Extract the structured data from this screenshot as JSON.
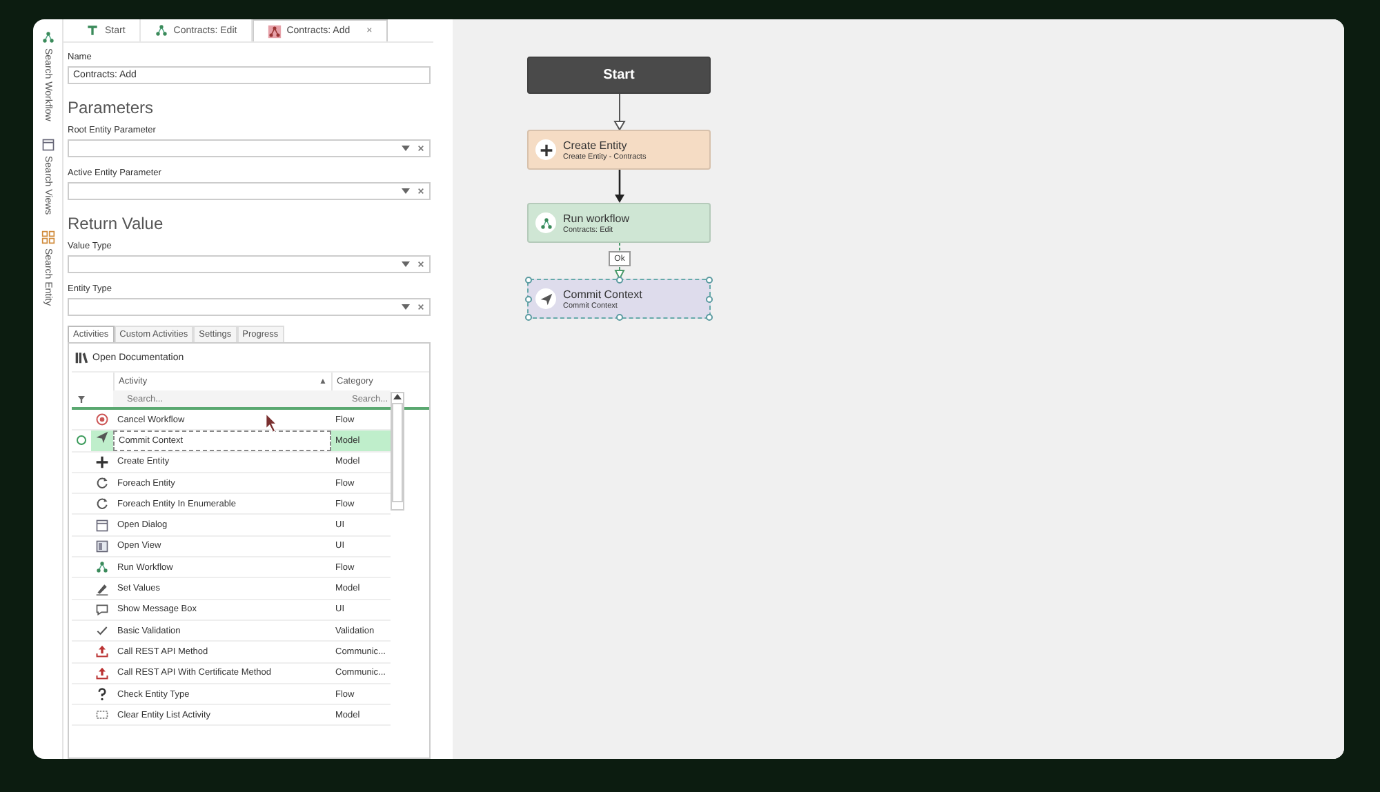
{
  "tabs": [
    {
      "label": "Start",
      "selected": false,
      "kind": "start"
    },
    {
      "label": "Contracts: Edit",
      "selected": false,
      "kind": "workflow"
    },
    {
      "label": "Contracts: Add",
      "selected": true,
      "kind": "workflow-active",
      "close": "×"
    }
  ],
  "sidebar": [
    {
      "label": "Search Workflow",
      "kind": "workflow"
    },
    {
      "label": "Search Views",
      "kind": "view"
    },
    {
      "label": "Search Entity",
      "kind": "entity"
    }
  ],
  "name_field": {
    "label": "Name",
    "value": "Contracts: Add"
  },
  "sections": [
    {
      "heading": "Parameters",
      "fields": [
        {
          "label": "Root Entity Parameter"
        },
        {
          "label": "Active Entity Parameter"
        }
      ]
    },
    {
      "heading": "Return Value",
      "fields": [
        {
          "label": "Value Type"
        },
        {
          "label": "Entity Type"
        }
      ]
    }
  ],
  "panel_tabs": [
    {
      "label": "Activities",
      "selected": true
    },
    {
      "label": "Custom Activities",
      "selected": false
    },
    {
      "label": "Settings",
      "selected": false
    },
    {
      "label": "Progress",
      "selected": false
    }
  ],
  "open_documentation": "Open Documentation",
  "table": {
    "columns": [
      {
        "label": "Activity",
        "sort": "▲"
      },
      {
        "label": "Category"
      }
    ],
    "search_placeholders": [
      "Search...",
      "Search..."
    ],
    "rows": [
      {
        "activity": "Cancel Workflow",
        "category": "Flow",
        "kind": "cancel",
        "selected": false
      },
      {
        "activity": "Commit Context",
        "category": "Model",
        "kind": "send",
        "selected": true
      },
      {
        "activity": "Create Entity",
        "category": "Model",
        "kind": "plus",
        "selected": false
      },
      {
        "activity": "Foreach Entity",
        "category": "Flow",
        "kind": "loop",
        "selected": false
      },
      {
        "activity": "Foreach Entity In Enumerable",
        "category": "Flow",
        "kind": "loop",
        "selected": false
      },
      {
        "activity": "Open Dialog",
        "category": "UI",
        "kind": "dialog",
        "selected": false
      },
      {
        "activity": "Open View",
        "category": "UI",
        "kind": "view",
        "selected": false
      },
      {
        "activity": "Run Workflow",
        "category": "Flow",
        "kind": "workflow",
        "selected": false
      },
      {
        "activity": "Set Values",
        "category": "Model",
        "kind": "pen",
        "selected": false
      },
      {
        "activity": "Show Message Box",
        "category": "UI",
        "kind": "message",
        "selected": false
      },
      {
        "activity": "Basic Validation",
        "category": "Validation",
        "kind": "check",
        "selected": false
      },
      {
        "activity": "Call REST API Method",
        "category": "Communic...",
        "kind": "upload",
        "selected": false
      },
      {
        "activity": "Call REST API With Certificate Method",
        "category": "Communic...",
        "kind": "upload",
        "selected": false
      },
      {
        "activity": "Check Entity Type",
        "category": "Flow",
        "kind": "question",
        "selected": false
      },
      {
        "activity": "Clear Entity List Activity",
        "category": "Model",
        "kind": "list",
        "selected": false
      }
    ]
  },
  "canvas": {
    "nodes": [
      {
        "title": "Start",
        "kind": "start",
        "color": "#4a4a4a",
        "selected": false
      },
      {
        "title": "Create Entity",
        "subtitle": "Create Entity - Contracts",
        "kind": "plus",
        "color": "#f5dcc4",
        "selected": false
      },
      {
        "title": "Run workflow",
        "subtitle": "Contracts: Edit",
        "kind": "workflow",
        "color": "#cfe6d4",
        "selected": false
      },
      {
        "title": "Commit Context",
        "subtitle": "Commit Context",
        "kind": "send",
        "color": "#dedcec",
        "selected": true
      }
    ],
    "connectors": [
      {
        "kind": "hollow"
      },
      {
        "kind": "filled"
      },
      {
        "kind": "dashed",
        "label": "Ok"
      }
    ]
  }
}
